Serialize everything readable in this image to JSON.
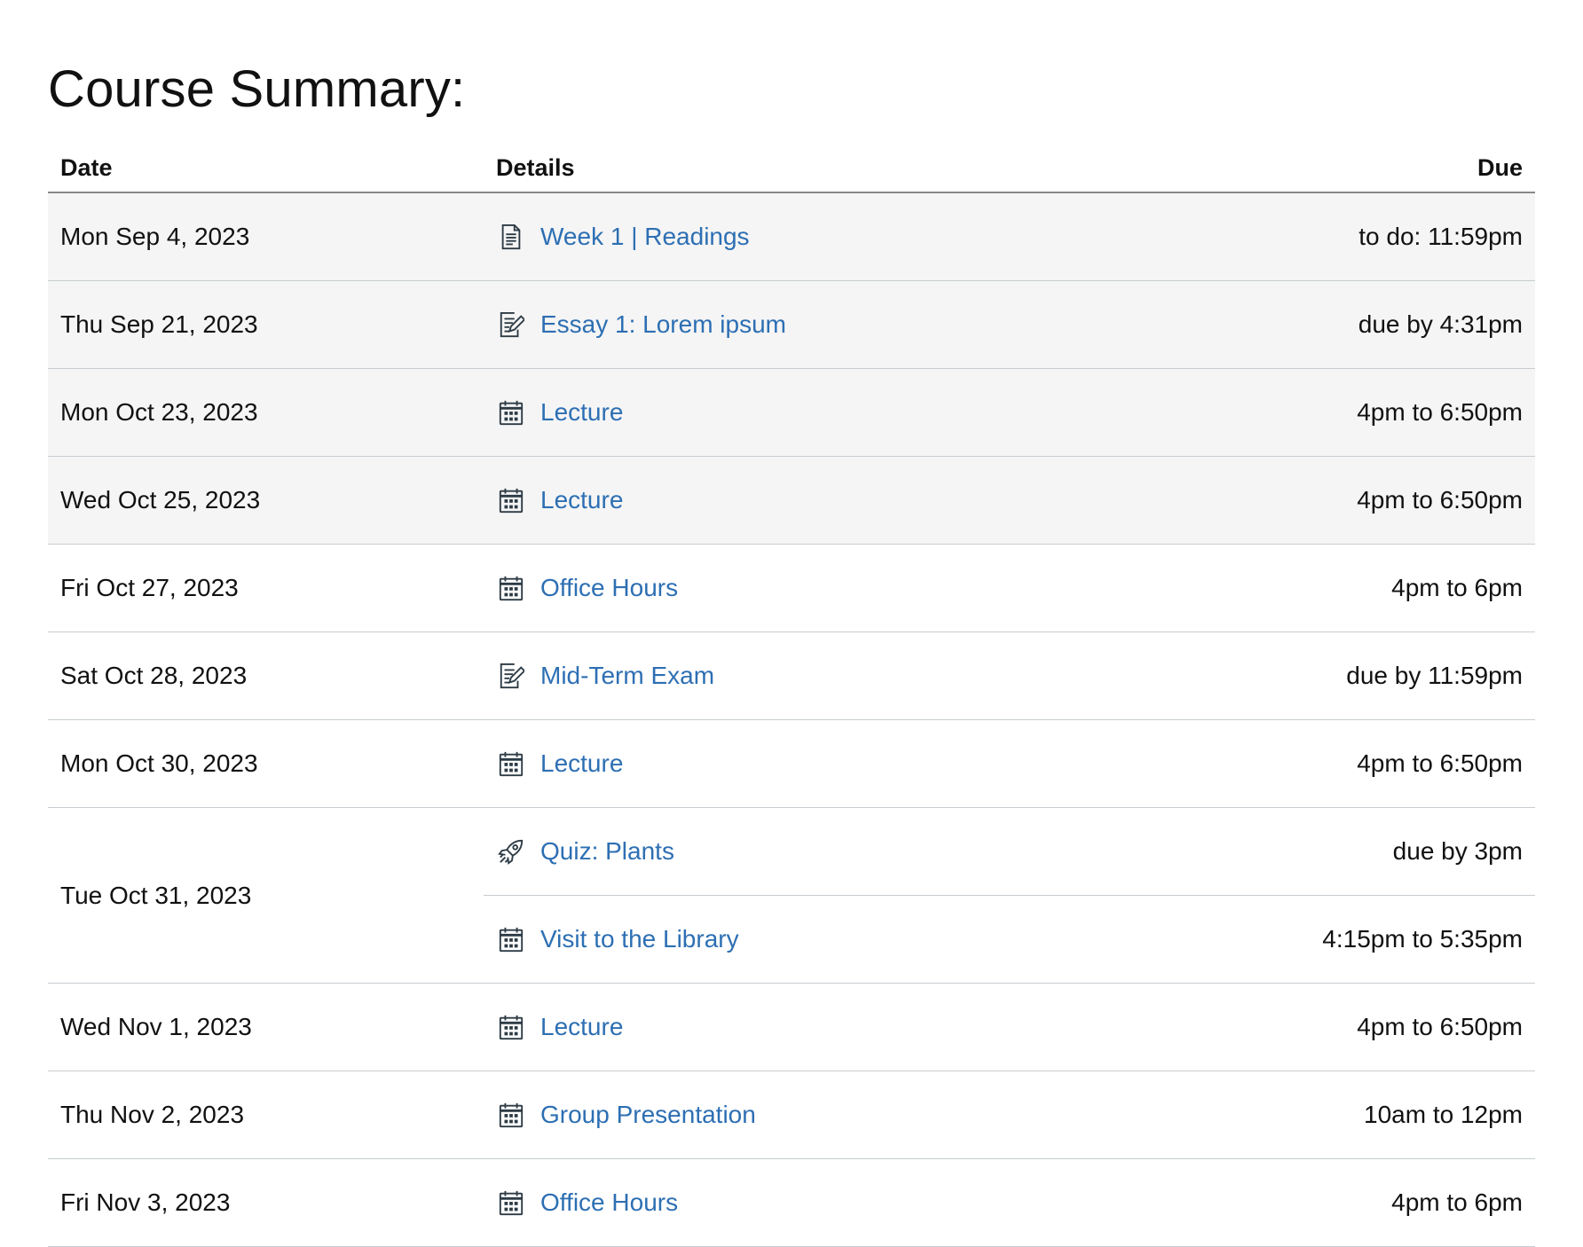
{
  "page": {
    "title": "Course Summary:"
  },
  "table": {
    "headers": {
      "date": "Date",
      "details": "Details",
      "due": "Due"
    },
    "link_color": "#2d6fb3",
    "rows": [
      {
        "date": "Mon Sep 4, 2023",
        "icon": "page-icon",
        "title": "Week 1 | Readings",
        "due": "to do: 11:59pm"
      },
      {
        "date": "Thu Sep 21, 2023",
        "icon": "assignment-icon",
        "title": "Essay 1: Lorem ipsum",
        "due": "due by 4:31pm"
      },
      {
        "date": "Mon Oct 23, 2023",
        "icon": "calendar-icon",
        "title": "Lecture",
        "due": "4pm to 6:50pm"
      },
      {
        "date": "Wed Oct 25, 2023",
        "icon": "calendar-icon",
        "title": "Lecture",
        "due": "4pm to 6:50pm"
      },
      {
        "date": "Fri Oct 27, 2023",
        "icon": "calendar-icon",
        "title": "Office Hours",
        "due": "4pm to 6pm"
      },
      {
        "date": "Sat Oct 28, 2023",
        "icon": "assignment-icon",
        "title": "Mid-Term Exam",
        "due": "due by 11:59pm"
      },
      {
        "date": "Mon Oct 30, 2023",
        "icon": "calendar-icon",
        "title": "Lecture",
        "due": "4pm to 6:50pm"
      },
      {
        "date": "Tue Oct 31, 2023",
        "icon": "quiz-rocket-icon",
        "title": "Quiz: Plants",
        "due": "due by 3pm"
      },
      {
        "date": "",
        "icon": "calendar-icon",
        "title": "Visit to the Library",
        "due": "4:15pm to 5:35pm"
      },
      {
        "date": "Wed Nov 1, 2023",
        "icon": "calendar-icon",
        "title": "Lecture",
        "due": "4pm to 6:50pm"
      },
      {
        "date": "Thu Nov 2, 2023",
        "icon": "calendar-icon",
        "title": "Group Presentation",
        "due": "10am to 12pm"
      },
      {
        "date": "Fri Nov 3, 2023",
        "icon": "calendar-icon",
        "title": "Office Hours",
        "due": "4pm to 6pm"
      }
    ]
  }
}
